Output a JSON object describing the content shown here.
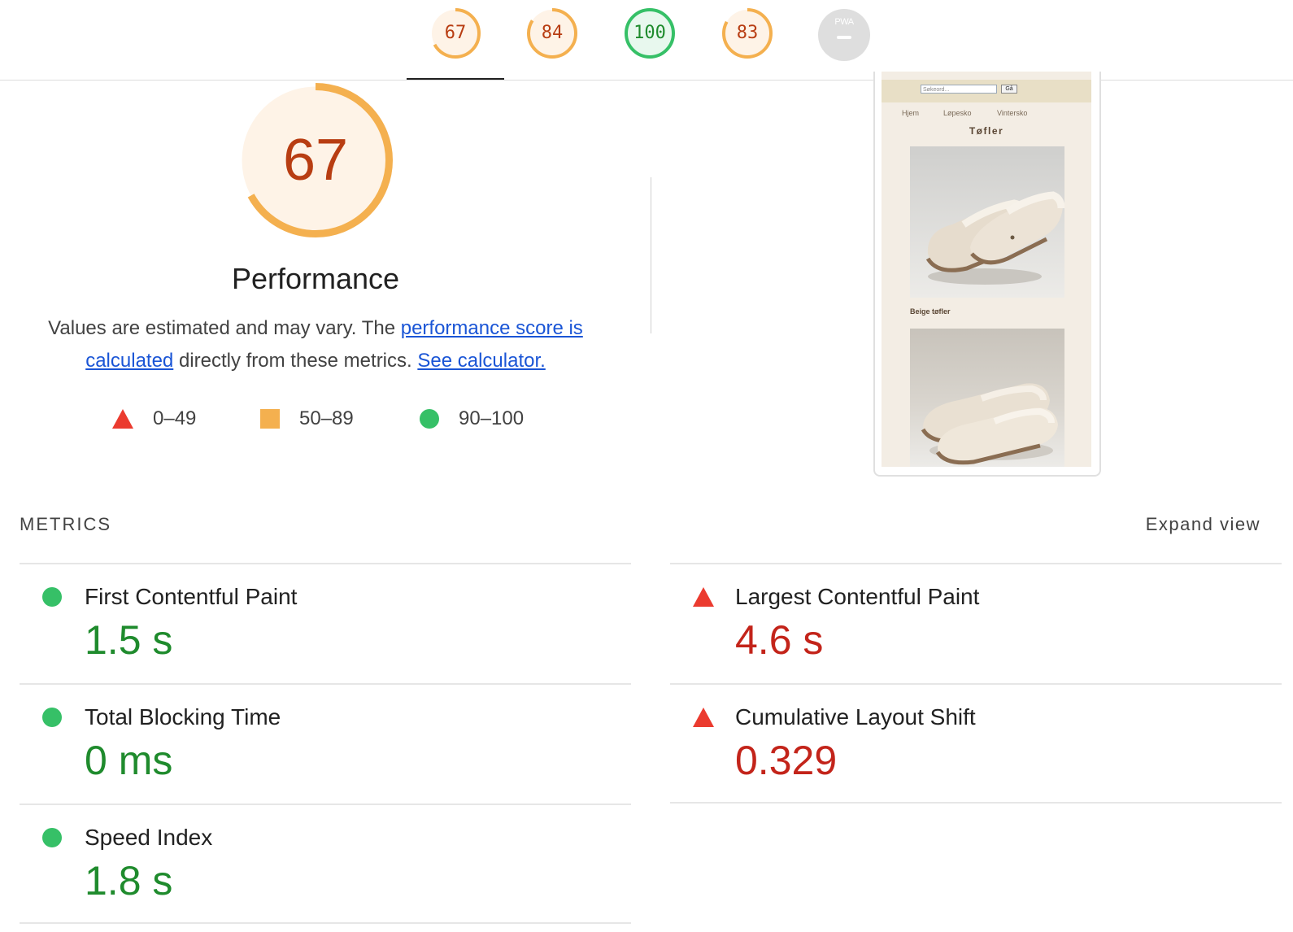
{
  "score_tabs": [
    {
      "score": "67",
      "name": "performance",
      "color": "#f4b04f",
      "text_color": "#b83d12",
      "fill": "#fef3e7",
      "fraction": 0.67
    },
    {
      "score": "84",
      "name": "accessibility",
      "color": "#f4b04f",
      "text_color": "#b83d12",
      "fill": "#fef3e7",
      "fraction": 0.84
    },
    {
      "score": "100",
      "name": "best-practices",
      "color": "#36c067",
      "text_color": "#1f8b2d",
      "fill": "#e8f8ee",
      "fraction": 1.0
    },
    {
      "score": "83",
      "name": "seo",
      "color": "#f4b04f",
      "text_color": "#b83d12",
      "fill": "#fef3e7",
      "fraction": 0.83
    }
  ],
  "pwa": {
    "label": "PWA",
    "icon": "dash-icon"
  },
  "performance": {
    "score": "67",
    "fraction": 0.67,
    "title": "Performance",
    "desc_prefix": "Values are estimated and may vary. The ",
    "desc_link": "performance score is calculated",
    "desc_middle": " directly from these metrics. ",
    "desc_link2": "See calculator."
  },
  "legend": [
    {
      "range": "0–49",
      "icon": "triangle-icon",
      "color": "#eb3b2f"
    },
    {
      "range": "50–89",
      "icon": "square-icon",
      "color": "#f4b04f"
    },
    {
      "range": "90–100",
      "icon": "circle-icon",
      "color": "#36c067"
    }
  ],
  "thumbnail": {
    "search_placeholder": "Søkeord...",
    "search_button": "Gå",
    "nav": [
      "Hjem",
      "Løpesko",
      "Vintersko"
    ],
    "title": "Tøfler",
    "caption": "Beige tøfler"
  },
  "metrics": {
    "heading": "METRICS",
    "expand_label": "Expand view",
    "items": [
      {
        "label": "First Contentful Paint",
        "value": "1.5 s",
        "status": "good"
      },
      {
        "label": "Largest Contentful Paint",
        "value": "4.6 s",
        "status": "poor"
      },
      {
        "label": "Total Blocking Time",
        "value": "0 ms",
        "status": "good"
      },
      {
        "label": "Cumulative Layout Shift",
        "value": "0.329",
        "status": "poor"
      },
      {
        "label": "Speed Index",
        "value": "1.8 s",
        "status": "good"
      }
    ]
  }
}
